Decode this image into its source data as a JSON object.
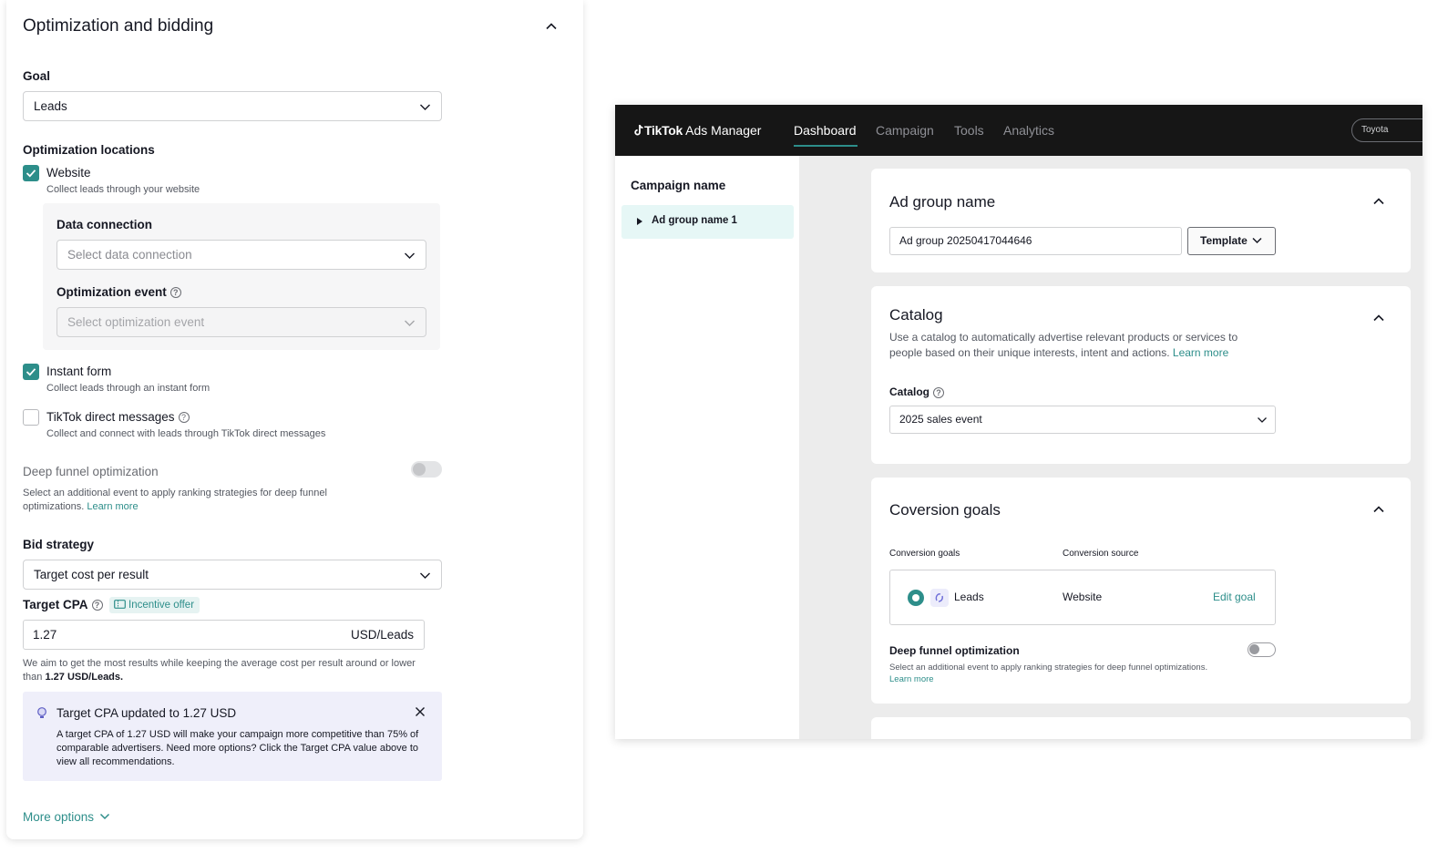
{
  "left_panel": {
    "title": "Optimization and bidding",
    "goal_label": "Goal",
    "goal_value": "Leads",
    "opt_locations_label": "Optimization locations",
    "website": {
      "label": "Website",
      "sub": "Collect leads through your website",
      "checked": true
    },
    "data_connection_label": "Data connection",
    "data_connection_placeholder": "Select data connection",
    "opt_event_label": "Optimization event",
    "opt_event_placeholder": "Select optimization event",
    "instant_form": {
      "label": "Instant form",
      "sub": "Collect leads through an instant form",
      "checked": true
    },
    "direct_messages": {
      "label": "TikTok direct messages",
      "sub": "Collect and connect with leads through TikTok direct messages",
      "checked": false
    },
    "deep_funnel": {
      "title": "Deep funnel optimization",
      "desc": "Select an additional event to apply ranking strategies for deep funnel optimizations.",
      "link": "Learn more"
    },
    "bid_strategy_label": "Bid strategy",
    "bid_strategy_value": "Target cost per result",
    "target_cpa_label": "Target CPA",
    "incentive_badge": "Incentive offer",
    "target_cpa_value": "1.27",
    "target_cpa_unit": "USD/Leads",
    "cpa_note_prefix": "We aim to get the most results while keeping the average cost per result around or lower than",
    "cpa_note_value": "1.27 USD/Leads.",
    "notice": {
      "title": "Target CPA updated to 1.27 USD",
      "body": "A target CPA of 1.27 USD will make your campaign more competitive than 75% of comparable advertisers. Need more options? Click the Target CPA value above to view all recommendations."
    },
    "more_options": "More options"
  },
  "ads_manager": {
    "brand": "TikTok",
    "brand_suffix": "Ads Manager",
    "tabs": [
      "Dashboard",
      "Campaign",
      "Tools",
      "Analytics"
    ],
    "active_tab": "Dashboard",
    "account": "Toyota",
    "sidebar": {
      "campaign_name": "Campaign name",
      "ad_group": "Ad group name 1"
    },
    "ad_group_card": {
      "title": "Ad group name",
      "input_value": "Ad group 20250417044646",
      "template_button": "Template"
    },
    "catalog_card": {
      "title": "Catalog",
      "desc": "Use a catalog to automatically advertise relevant products or services to people based on their unique interests, intent and actions.",
      "link": "Learn more",
      "catalog_label": "Catalog",
      "catalog_value": "2025 sales event"
    },
    "conversion_card": {
      "title": "Coversion goals",
      "col_goals": "Conversion goals",
      "col_source": "Conversion source",
      "goal": "Leads",
      "source": "Website",
      "edit": "Edit goal",
      "deep_funnel_title": "Deep funnel optimization",
      "deep_funnel_desc": "Select an additional event to apply ranking strategies for deep funnel optimizations.",
      "deep_funnel_link": "Learn more"
    }
  },
  "colors": {
    "accent": "#2d8e8a",
    "notice_bg": "#efeffa",
    "topbar": "#161616"
  },
  "icons": [
    "chevron-up-icon",
    "chevron-down-icon",
    "check-icon",
    "help-icon",
    "close-icon",
    "bulb-icon",
    "ticket-icon",
    "tiktok-logo-icon",
    "caret-right-icon",
    "radio-icon",
    "leads-icon"
  ]
}
